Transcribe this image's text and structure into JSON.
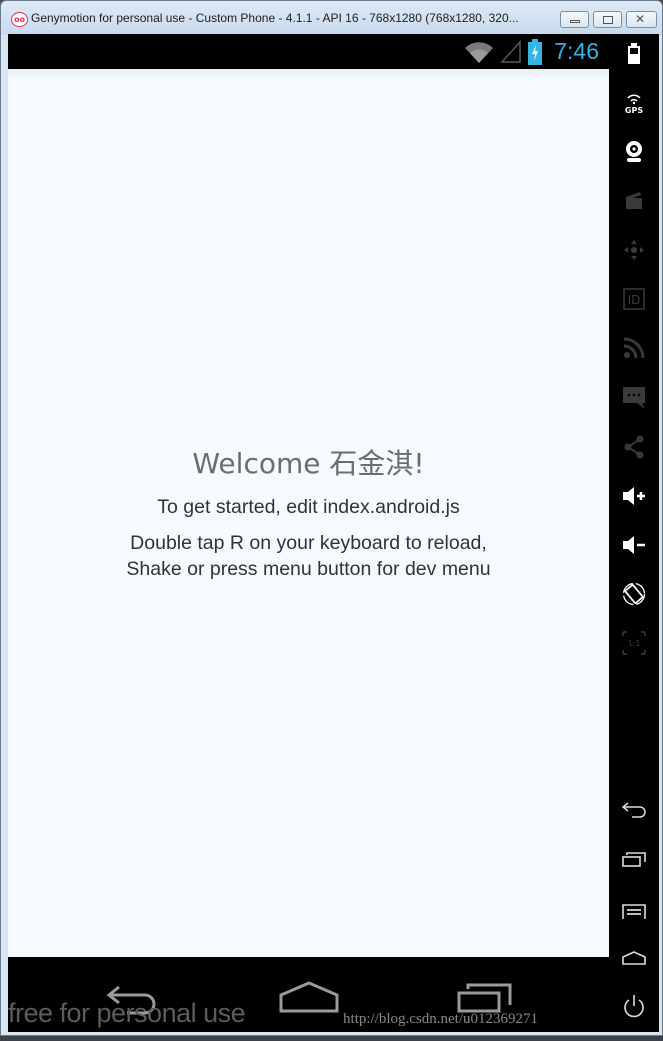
{
  "window": {
    "title": "Genymotion for personal use - Custom Phone - 4.1.1 - API 16 - 768x1280 (768x1280, 320...",
    "app_logo": "oo",
    "buttons": {
      "minimize": "minimize-button",
      "maximize": "maximize-button",
      "close": "close-button"
    }
  },
  "status_bar": {
    "icons": [
      "wifi-icon",
      "signal-icon",
      "battery-charging-icon"
    ],
    "time": "7:46",
    "accent_color": "#33b5e5"
  },
  "app": {
    "welcome": "Welcome 石金淇!",
    "instruction_1": "To get started, edit index.android.js",
    "instruction_2_line1": "Double tap R on your keyboard to reload,",
    "instruction_2_line2": "Shake or press menu button for dev menu",
    "background_color": "#f4faff"
  },
  "nav_bar": {
    "buttons": [
      "back",
      "home",
      "recent-apps"
    ]
  },
  "sidebar": {
    "items": [
      {
        "name": "battery",
        "label": ""
      },
      {
        "name": "gps",
        "label": "GPS"
      },
      {
        "name": "webcam",
        "label": ""
      },
      {
        "name": "capture",
        "label": ""
      },
      {
        "name": "remote-control",
        "label": ""
      },
      {
        "name": "device-id",
        "label": "ID"
      },
      {
        "name": "network",
        "label": ""
      },
      {
        "name": "sms",
        "label": ""
      },
      {
        "name": "share",
        "label": ""
      },
      {
        "name": "volume-up",
        "label": ""
      },
      {
        "name": "volume-down",
        "label": ""
      },
      {
        "name": "rotate",
        "label": ""
      },
      {
        "name": "pixel-perfect",
        "label": "1:1"
      },
      {
        "name": "back",
        "label": ""
      },
      {
        "name": "recent-apps",
        "label": ""
      },
      {
        "name": "menu",
        "label": ""
      },
      {
        "name": "home",
        "label": ""
      },
      {
        "name": "power",
        "label": ""
      }
    ]
  },
  "watermark": {
    "text": "free for personal use",
    "url": "http://blog.csdn.net/u012369271"
  }
}
